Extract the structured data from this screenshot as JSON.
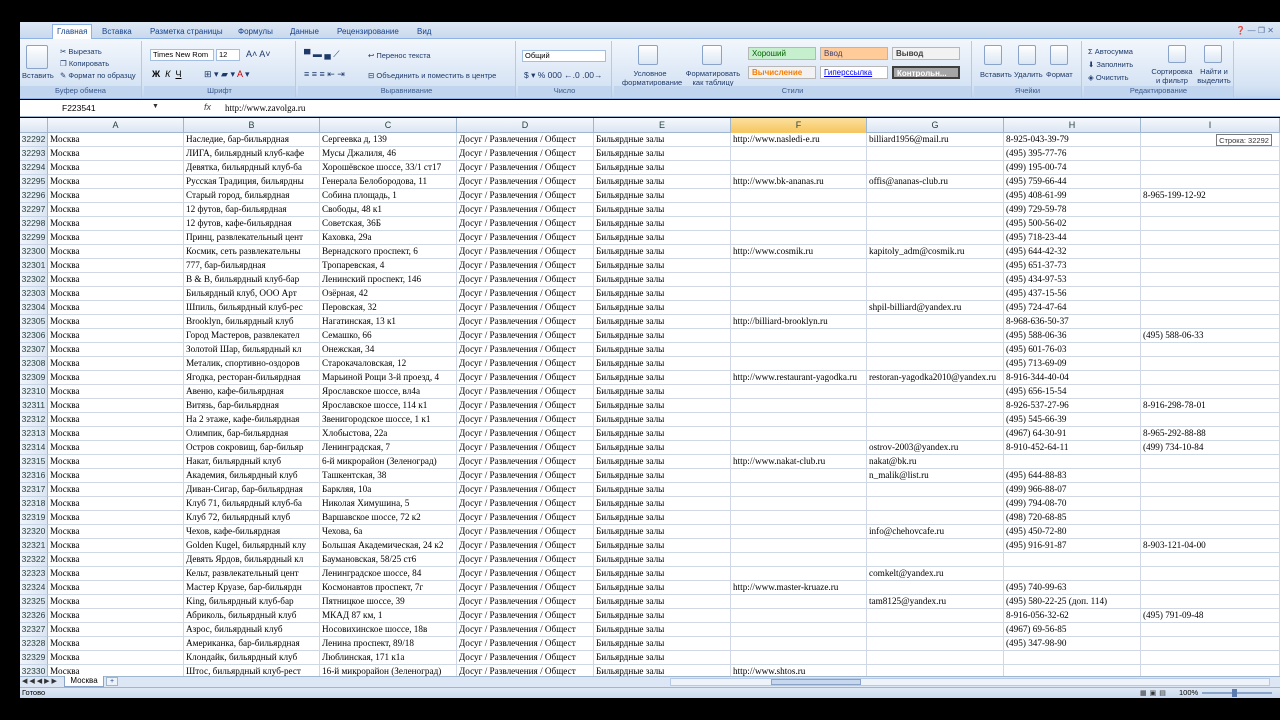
{
  "ribbon_tabs": [
    "Главная",
    "Вставка",
    "Разметка страницы",
    "Формулы",
    "Данные",
    "Рецензирование",
    "Вид"
  ],
  "window_controls": "❓ — ❐ ✕",
  "clipboard": {
    "paste": "Вставить",
    "cut": "Вырезать",
    "copy": "Копировать",
    "format": "Формат по образцу",
    "label": "Буфер обмена"
  },
  "font": {
    "name": "Times New Rom",
    "size": "12",
    "label": "Шрифт"
  },
  "align": {
    "wrap": "Перенос текста",
    "merge": "Объединить и поместить в центре",
    "label": "Выравнивание"
  },
  "number": {
    "format": "Общий",
    "label": "Число"
  },
  "styles": {
    "cond": "Условное форматирование",
    "table": "Форматировать как таблицу",
    "good": "Хороший",
    "input": "Ввод",
    "output": "Вывод",
    "calc": "Вычисление",
    "link": "Гиперссылка",
    "control": "Контрольн...",
    "label": "Стили"
  },
  "cells_group": {
    "insert": "Вставить",
    "delete": "Удалить",
    "format": "Формат",
    "label": "Ячейки"
  },
  "editing": {
    "autosum": "Автосумма",
    "fill": "Заполнить",
    "clear": "Очистить",
    "sort": "Сортировка и фильтр",
    "find": "Найти и выделить",
    "label": "Редактирование"
  },
  "formula_bar": {
    "name_box": "F223541",
    "fx": "fx",
    "content": "http://www.zavolga.ru"
  },
  "columns": [
    "A",
    "B",
    "C",
    "D",
    "E",
    "F",
    "G",
    "H",
    "I"
  ],
  "selected_column": "F",
  "tooltip": "Строка: 32292",
  "rows": [
    {
      "n": "32292",
      "a": "Москва",
      "b": "Наследие, бар-бильярдная",
      "c": "Сергеевка д, 139",
      "d": "Досуг / Развлечения / Общест",
      "e": "Бильярдные залы",
      "f": "http://www.nasledi-e.ru",
      "g": "billiard1956@mail.ru",
      "h": "8-925-043-39-79",
      "i": ""
    },
    {
      "n": "32293",
      "a": "Москва",
      "b": "ЛИГА, бильярдный клуб-кафе",
      "c": "Мусы Джалиля, 46",
      "d": "Досуг / Развлечения / Общест",
      "e": "Бильярдные залы",
      "f": "",
      "g": "",
      "h": "(495) 395-77-76",
      "i": ""
    },
    {
      "n": "32294",
      "a": "Москва",
      "b": "Девятка, бильярдный клуб-ба",
      "c": "Хорошёвское шоссе, 33/1 ст17",
      "d": "Досуг / Развлечения / Общест",
      "e": "Бильярдные залы",
      "f": "",
      "g": "",
      "h": "(499) 195-00-74",
      "i": ""
    },
    {
      "n": "32295",
      "a": "Москва",
      "b": "Русская Традиция, бильярдны",
      "c": "Генерала Белобородова, 11",
      "d": "Досуг / Развлечения / Общест",
      "e": "Бильярдные залы",
      "f": "http://www.bk-ananas.ru",
      "g": "offis@ananas-club.ru",
      "h": "(495) 759-66-44",
      "i": ""
    },
    {
      "n": "32296",
      "a": "Москва",
      "b": "Старый город, бильярдная",
      "c": "Собина площадь, 1",
      "d": "Досуг / Развлечения / Общест",
      "e": "Бильярдные залы",
      "f": "",
      "g": "",
      "h": "(495) 408-61-99",
      "i": "8-965-199-12-92"
    },
    {
      "n": "32297",
      "a": "Москва",
      "b": "12 футов, бар-бильярдная",
      "c": "Свободы, 48 к1",
      "d": "Досуг / Развлечения / Общест",
      "e": "Бильярдные залы",
      "f": "",
      "g": "",
      "h": "(499) 729-59-78",
      "i": ""
    },
    {
      "n": "32298",
      "a": "Москва",
      "b": "12 футов, кафе-бильярдная",
      "c": "Советская, 36Б",
      "d": "Досуг / Развлечения / Общест",
      "e": "Бильярдные залы",
      "f": "",
      "g": "",
      "h": "(495) 500-56-02",
      "i": ""
    },
    {
      "n": "32299",
      "a": "Москва",
      "b": "Принц, развлекательный цент",
      "c": "Каховка, 29а",
      "d": "Досуг / Развлечения / Общест",
      "e": "Бильярдные залы",
      "f": "",
      "g": "",
      "h": "(495) 718-23-44",
      "i": ""
    },
    {
      "n": "32300",
      "a": "Москва",
      "b": "Космик, сеть развлекательны",
      "c": "Вернадского проспект, 6",
      "d": "Досуг / Развлечения / Общест",
      "e": "Бильярдные залы",
      "f": "http://www.cosmik.ru",
      "g": "kapitoly_adm@cosmik.ru",
      "h": "(495) 644-42-32",
      "i": ""
    },
    {
      "n": "32301",
      "a": "Москва",
      "b": "777, бар-бильярдная",
      "c": "Тропаревская, 4",
      "d": "Досуг / Развлечения / Общест",
      "e": "Бильярдные залы",
      "f": "",
      "g": "",
      "h": "(495) 651-37-73",
      "i": ""
    },
    {
      "n": "32302",
      "a": "Москва",
      "b": "В & В, бильярдный клуб-бар",
      "c": "Ленинский проспект, 146",
      "d": "Досуг / Развлечения / Общест",
      "e": "Бильярдные залы",
      "f": "",
      "g": "",
      "h": "(495) 434-97-53",
      "i": ""
    },
    {
      "n": "32303",
      "a": "Москва",
      "b": "Бильярдный клуб, ООО Арт",
      "c": "Озёрная, 42",
      "d": "Досуг / Развлечения / Общест",
      "e": "Бильярдные залы",
      "f": "",
      "g": "",
      "h": "(495) 437-15-56",
      "i": ""
    },
    {
      "n": "32304",
      "a": "Москва",
      "b": "Шпиль, бильярдный клуб-рес",
      "c": "Перовская, 32",
      "d": "Досуг / Развлечения / Общест",
      "e": "Бильярдные залы",
      "f": "",
      "g": "shpil-billiard@yandex.ru",
      "h": "(495) 724-47-64",
      "i": ""
    },
    {
      "n": "32305",
      "a": "Москва",
      "b": "Brooklyn, бильярдный клуб",
      "c": "Нагатинская, 13 к1",
      "d": "Досуг / Развлечения / Общест",
      "e": "Бильярдные залы",
      "f": "http://billiard-brooklyn.ru",
      "g": "",
      "h": "8-968-636-50-37",
      "i": ""
    },
    {
      "n": "32306",
      "a": "Москва",
      "b": "Город Мастеров, развлекател",
      "c": "Семашко, 66",
      "d": "Досуг / Развлечения / Общест",
      "e": "Бильярдные залы",
      "f": "",
      "g": "",
      "h": "(495) 588-06-36",
      "i": "(495) 588-06-33"
    },
    {
      "n": "32307",
      "a": "Москва",
      "b": "Золотой Шар, бильярдный кл",
      "c": "Онежская, 34",
      "d": "Досуг / Развлечения / Общест",
      "e": "Бильярдные залы",
      "f": "",
      "g": "",
      "h": "(495) 601-76-03",
      "i": ""
    },
    {
      "n": "32308",
      "a": "Москва",
      "b": "Металик, спортивно-оздоров",
      "c": "Старокачаловская, 12",
      "d": "Досуг / Развлечения / Общест",
      "e": "Бильярдные залы",
      "f": "",
      "g": "",
      "h": "(495) 713-69-09",
      "i": ""
    },
    {
      "n": "32309",
      "a": "Москва",
      "b": "Ягодка, ресторан-бильярдная",
      "c": "Марьиной Рощи 3-й проезд, 4",
      "d": "Досуг / Развлечения / Общест",
      "e": "Бильярдные залы",
      "f": "http://www.restaurant-yagodka.ru",
      "g": "restoran-yagodka2010@yandex.ru",
      "h": "8-916-344-40-04",
      "i": ""
    },
    {
      "n": "32310",
      "a": "Москва",
      "b": "Авеню, кафе-бильярдная",
      "c": "Ярославское шоссе, вл4а",
      "d": "Досуг / Развлечения / Общест",
      "e": "Бильярдные залы",
      "f": "",
      "g": "",
      "h": "(495) 656-15-54",
      "i": ""
    },
    {
      "n": "32311",
      "a": "Москва",
      "b": "Витязь, бар-бильярдная",
      "c": "Ярославское шоссе, 114 к1",
      "d": "Досуг / Развлечения / Общест",
      "e": "Бильярдные залы",
      "f": "",
      "g": "",
      "h": "8-926-537-27-96",
      "i": "8-916-298-78-01"
    },
    {
      "n": "32312",
      "a": "Москва",
      "b": "На 2 этаже, кафе-бильярдная",
      "c": "Звенигородское шоссе, 1 к1",
      "d": "Досуг / Развлечения / Общест",
      "e": "Бильярдные залы",
      "f": "",
      "g": "",
      "h": "(495) 545-66-39",
      "i": ""
    },
    {
      "n": "32313",
      "a": "Москва",
      "b": "Олимпик, бар-бильярдная",
      "c": "Хлобыстова, 22а",
      "d": "Досуг / Развлечения / Общест",
      "e": "Бильярдные залы",
      "f": "",
      "g": "",
      "h": "(4967) 64-30-91",
      "i": "8-965-292-88-88"
    },
    {
      "n": "32314",
      "a": "Москва",
      "b": "Остров сокровищ, бар-бильяр",
      "c": "Ленинградская, 7",
      "d": "Досуг / Развлечения / Общест",
      "e": "Бильярдные залы",
      "f": "",
      "g": "ostrov-2003@yandex.ru",
      "h": "8-910-452-64-11",
      "i": "(499) 734-10-84"
    },
    {
      "n": "32315",
      "a": "Москва",
      "b": "Накат, бильярдный клуб",
      "c": "6-й микрорайон (Зеленоград)",
      "d": "Досуг / Развлечения / Общест",
      "e": "Бильярдные залы",
      "f": "http://www.nakat-club.ru",
      "g": "nakat@bk.ru",
      "h": "",
      "i": ""
    },
    {
      "n": "32316",
      "a": "Москва",
      "b": "Академия, бильярдный клуб",
      "c": "Ташкентская, 38",
      "d": "Досуг / Развлечения / Общест",
      "e": "Бильярдные залы",
      "f": "",
      "g": "n_malik@list.ru",
      "h": "(495) 644-88-83",
      "i": ""
    },
    {
      "n": "32317",
      "a": "Москва",
      "b": "Диван-Сигар, бар-бильярдная",
      "c": "Баркляя, 10а",
      "d": "Досуг / Развлечения / Общест",
      "e": "Бильярдные залы",
      "f": "",
      "g": "",
      "h": "(499) 966-88-07",
      "i": ""
    },
    {
      "n": "32318",
      "a": "Москва",
      "b": "Клуб 71, бильярдный клуб-ба",
      "c": "Николая Химушина, 5",
      "d": "Досуг / Развлечения / Общест",
      "e": "Бильярдные залы",
      "f": "",
      "g": "",
      "h": "(499) 794-08-70",
      "i": ""
    },
    {
      "n": "32319",
      "a": "Москва",
      "b": "Клуб 72, бильярдный клуб",
      "c": "Варшавское шоссе, 72 к2",
      "d": "Досуг / Развлечения / Общест",
      "e": "Бильярдные залы",
      "f": "",
      "g": "",
      "h": "(498) 720-68-85",
      "i": ""
    },
    {
      "n": "32320",
      "a": "Москва",
      "b": "Чехов, кафе-бильярдная",
      "c": "Чехова, 6а",
      "d": "Досуг / Развлечения / Общест",
      "e": "Бильярдные залы",
      "f": "",
      "g": "info@chehovcafe.ru",
      "h": "(495) 450-72-80",
      "i": ""
    },
    {
      "n": "32321",
      "a": "Москва",
      "b": "Golden Kugel, бильярдный клу",
      "c": "Большая Академическая, 24 к2",
      "d": "Досуг / Развлечения / Общест",
      "e": "Бильярдные залы",
      "f": "",
      "g": "",
      "h": "(495) 916-91-87",
      "i": "8-903-121-04-00"
    },
    {
      "n": "32322",
      "a": "Москва",
      "b": "Девять Ярдов, бильярдный кл",
      "c": "Баумановская, 58/25 ст6",
      "d": "Досуг / Развлечения / Общест",
      "e": "Бильярдные залы",
      "f": "",
      "g": "",
      "h": "",
      "i": ""
    },
    {
      "n": "32323",
      "a": "Москва",
      "b": "Кельт, развлекательный цент",
      "c": "Ленинградское шоссе, 84",
      "d": "Досуг / Развлечения / Общест",
      "e": "Бильярдные залы",
      "f": "",
      "g": "comkelt@yandex.ru",
      "h": "",
      "i": ""
    },
    {
      "n": "32324",
      "a": "Москва",
      "b": "Мастер Круазе, бар-бильярдн",
      "c": "Космонавтов проспект, 7г",
      "d": "Досуг / Развлечения / Общест",
      "e": "Бильярдные залы",
      "f": "http://www.master-kruaze.ru",
      "g": "",
      "h": "(495) 740-99-63",
      "i": ""
    },
    {
      "n": "32325",
      "a": "Москва",
      "b": "King, бильярдный клуб-бар",
      "c": "Пятницкое шоссе, 39",
      "d": "Досуг / Развлечения / Общест",
      "e": "Бильярдные залы",
      "f": "",
      "g": "tam8125@yandex.ru",
      "h": "(495) 580-22-25 (доп. 114)",
      "i": ""
    },
    {
      "n": "32326",
      "a": "Москва",
      "b": "Абриколь, бильярдный клуб",
      "c": "МКАД 87 км, 1",
      "d": "Досуг / Развлечения / Общест",
      "e": "Бильярдные залы",
      "f": "",
      "g": "",
      "h": "8-916-056-32-62",
      "i": "(495) 791-09-48"
    },
    {
      "n": "32327",
      "a": "Москва",
      "b": "Азрос, бильярдный клуб",
      "c": "Носовихинское шоссе, 18в",
      "d": "Досуг / Развлечения / Общест",
      "e": "Бильярдные залы",
      "f": "",
      "g": "",
      "h": "(4967) 69-56-85",
      "i": ""
    },
    {
      "n": "32328",
      "a": "Москва",
      "b": "Американка, бар-бильярдная",
      "c": "Ленина проспект, 89/18",
      "d": "Досуг / Развлечения / Общест",
      "e": "Бильярдные залы",
      "f": "",
      "g": "",
      "h": "(495) 347-98-90",
      "i": ""
    },
    {
      "n": "32329",
      "a": "Москва",
      "b": "Клондайк, бильярдный клуб",
      "c": "Люблинская, 171 к1а",
      "d": "Досуг / Развлечения / Общест",
      "e": "Бильярдные залы",
      "f": "",
      "g": "",
      "h": "",
      "i": ""
    },
    {
      "n": "32330",
      "a": "Москва",
      "b": "Штос, бильярдный клуб-рест",
      "c": "16-й микрорайон (Зеленоград)",
      "d": "Досуг / Развлечения / Общест",
      "e": "Бильярдные залы",
      "f": "http://www.shtos.ru",
      "g": "",
      "h": "",
      "i": ""
    }
  ],
  "sheet_tab": "Москва",
  "status": "Готово",
  "zoom": "100%"
}
